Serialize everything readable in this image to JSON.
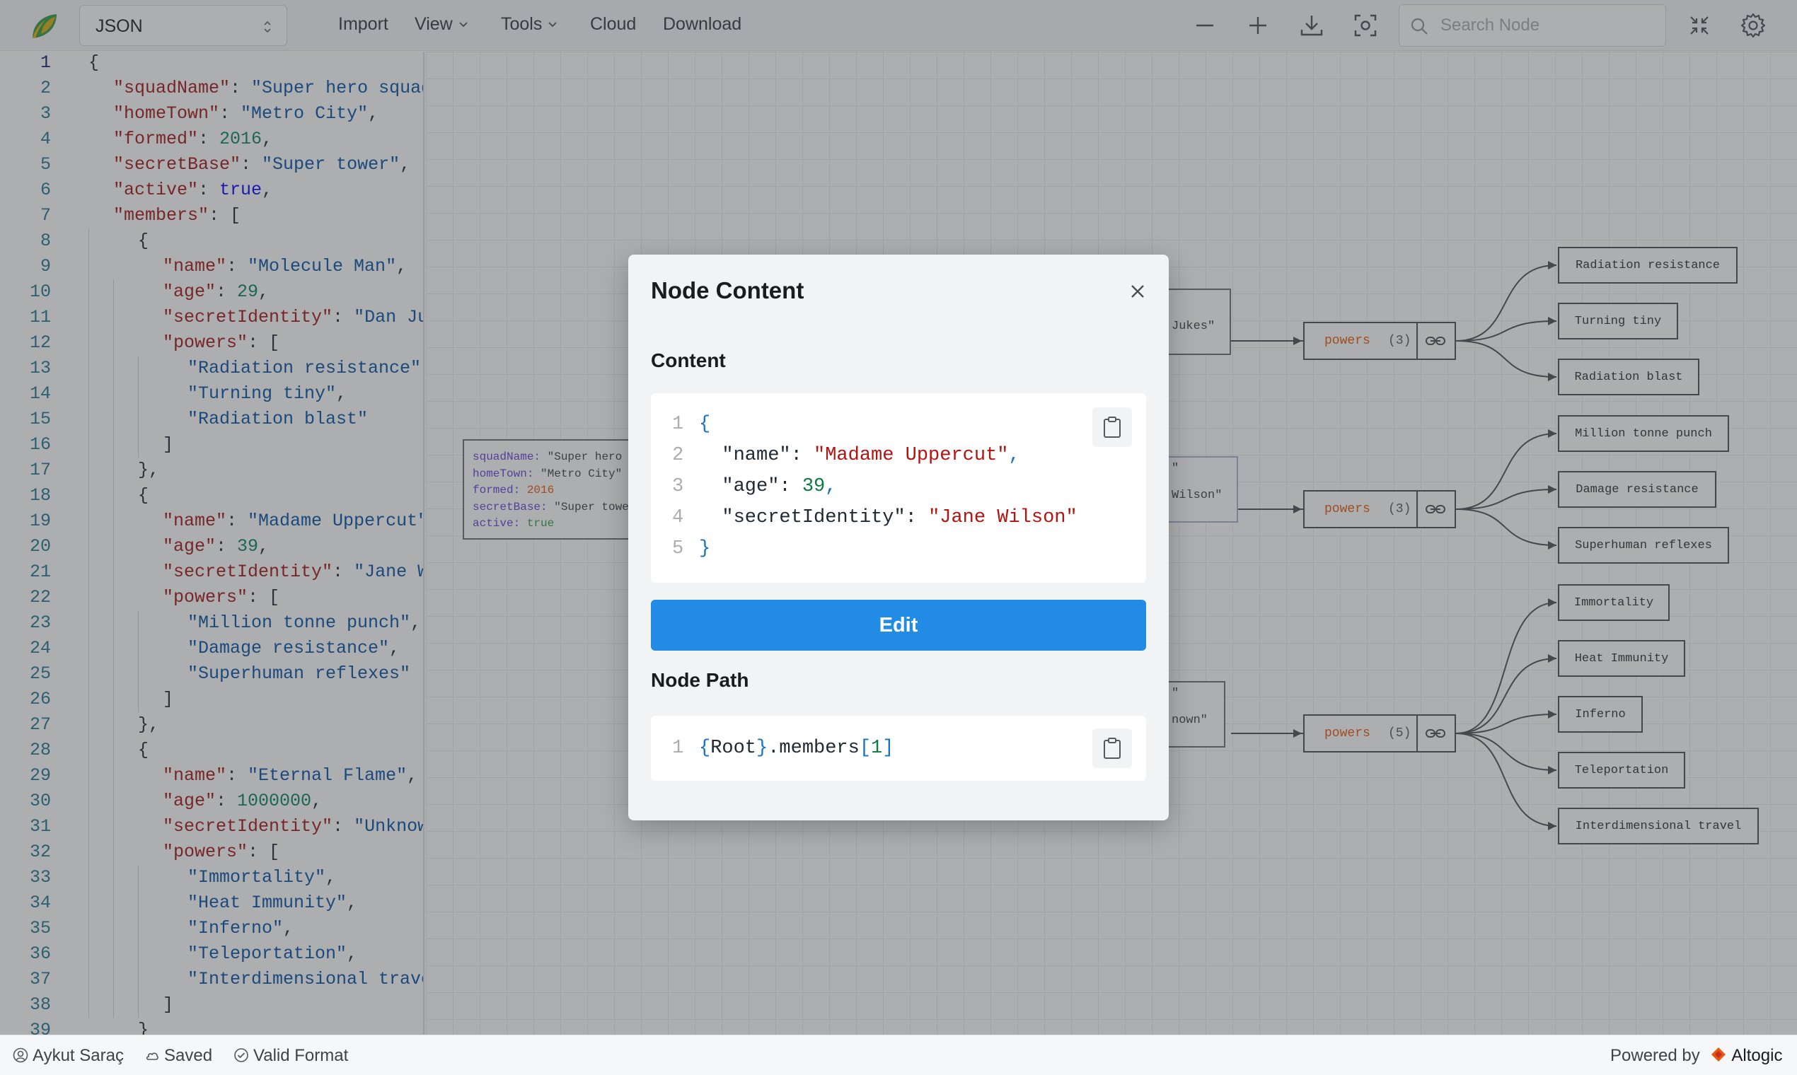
{
  "toolbar": {
    "format": "JSON",
    "menus": {
      "import": "Import",
      "view": "View",
      "tools": "Tools",
      "cloud": "Cloud",
      "download": "Download"
    },
    "search_placeholder": "Search Node",
    "icons": [
      "zoom-out-icon",
      "zoom-in-icon",
      "download-icon",
      "focus-icon",
      "fullscreen-icon",
      "settings-icon"
    ]
  },
  "editor": {
    "active_line": 1,
    "lines": [
      {
        "n": "1",
        "indent": 0,
        "parts": [
          [
            "p",
            "{"
          ]
        ]
      },
      {
        "n": "2",
        "indent": 1,
        "parts": [
          [
            "k",
            "\"squadName\""
          ],
          [
            "p",
            ": "
          ],
          [
            "s",
            "\"Super hero squad\""
          ]
        ]
      },
      {
        "n": "3",
        "indent": 1,
        "parts": [
          [
            "k",
            "\"homeTown\""
          ],
          [
            "p",
            ": "
          ],
          [
            "s",
            "\"Metro City\""
          ],
          [
            "p",
            ","
          ]
        ]
      },
      {
        "n": "4",
        "indent": 1,
        "parts": [
          [
            "k",
            "\"formed\""
          ],
          [
            "p",
            ": "
          ],
          [
            "n",
            "2016"
          ],
          [
            "p",
            ","
          ]
        ]
      },
      {
        "n": "5",
        "indent": 1,
        "parts": [
          [
            "k",
            "\"secretBase\""
          ],
          [
            "p",
            ": "
          ],
          [
            "s",
            "\"Super tower\""
          ],
          [
            "p",
            ","
          ]
        ]
      },
      {
        "n": "6",
        "indent": 1,
        "parts": [
          [
            "k",
            "\"active\""
          ],
          [
            "p",
            ": "
          ],
          [
            "b",
            "true"
          ],
          [
            "p",
            ","
          ]
        ]
      },
      {
        "n": "7",
        "indent": 1,
        "parts": [
          [
            "k",
            "\"members\""
          ],
          [
            "p",
            ": ["
          ]
        ]
      },
      {
        "n": "8",
        "indent": 2,
        "parts": [
          [
            "p",
            "{"
          ]
        ]
      },
      {
        "n": "9",
        "indent": 3,
        "parts": [
          [
            "k",
            "\"name\""
          ],
          [
            "p",
            ": "
          ],
          [
            "s",
            "\"Molecule Man\""
          ],
          [
            "p",
            ","
          ]
        ]
      },
      {
        "n": "10",
        "indent": 3,
        "parts": [
          [
            "k",
            "\"age\""
          ],
          [
            "p",
            ": "
          ],
          [
            "n",
            "29"
          ],
          [
            "p",
            ","
          ]
        ]
      },
      {
        "n": "11",
        "indent": 3,
        "parts": [
          [
            "k",
            "\"secretIdentity\""
          ],
          [
            "p",
            ": "
          ],
          [
            "s",
            "\"Dan Jukes\""
          ]
        ]
      },
      {
        "n": "12",
        "indent": 3,
        "parts": [
          [
            "k",
            "\"powers\""
          ],
          [
            "p",
            ": ["
          ]
        ]
      },
      {
        "n": "13",
        "indent": 4,
        "parts": [
          [
            "s",
            "\"Radiation resistance\""
          ],
          [
            "p",
            ","
          ]
        ]
      },
      {
        "n": "14",
        "indent": 4,
        "parts": [
          [
            "s",
            "\"Turning tiny\""
          ],
          [
            "p",
            ","
          ]
        ]
      },
      {
        "n": "15",
        "indent": 4,
        "parts": [
          [
            "s",
            "\"Radiation blast\""
          ]
        ]
      },
      {
        "n": "16",
        "indent": 3,
        "parts": [
          [
            "p",
            "]"
          ]
        ]
      },
      {
        "n": "17",
        "indent": 2,
        "parts": [
          [
            "p",
            "},"
          ]
        ]
      },
      {
        "n": "18",
        "indent": 2,
        "parts": [
          [
            "p",
            "{"
          ]
        ]
      },
      {
        "n": "19",
        "indent": 3,
        "parts": [
          [
            "k",
            "\"name\""
          ],
          [
            "p",
            ": "
          ],
          [
            "s",
            "\"Madame Uppercut\""
          ],
          [
            "p",
            ","
          ]
        ]
      },
      {
        "n": "20",
        "indent": 3,
        "parts": [
          [
            "k",
            "\"age\""
          ],
          [
            "p",
            ": "
          ],
          [
            "n",
            "39"
          ],
          [
            "p",
            ","
          ]
        ]
      },
      {
        "n": "21",
        "indent": 3,
        "parts": [
          [
            "k",
            "\"secretIdentity\""
          ],
          [
            "p",
            ": "
          ],
          [
            "s",
            "\"Jane Wilson\""
          ]
        ]
      },
      {
        "n": "22",
        "indent": 3,
        "parts": [
          [
            "k",
            "\"powers\""
          ],
          [
            "p",
            ": ["
          ]
        ]
      },
      {
        "n": "23",
        "indent": 4,
        "parts": [
          [
            "s",
            "\"Million tonne punch\""
          ],
          [
            "p",
            ","
          ]
        ]
      },
      {
        "n": "24",
        "indent": 4,
        "parts": [
          [
            "s",
            "\"Damage resistance\""
          ],
          [
            "p",
            ","
          ]
        ]
      },
      {
        "n": "25",
        "indent": 4,
        "parts": [
          [
            "s",
            "\"Superhuman reflexes\""
          ]
        ]
      },
      {
        "n": "26",
        "indent": 3,
        "parts": [
          [
            "p",
            "]"
          ]
        ]
      },
      {
        "n": "27",
        "indent": 2,
        "parts": [
          [
            "p",
            "},"
          ]
        ]
      },
      {
        "n": "28",
        "indent": 2,
        "parts": [
          [
            "p",
            "{"
          ]
        ]
      },
      {
        "n": "29",
        "indent": 3,
        "parts": [
          [
            "k",
            "\"name\""
          ],
          [
            "p",
            ": "
          ],
          [
            "s",
            "\"Eternal Flame\""
          ],
          [
            "p",
            ","
          ]
        ]
      },
      {
        "n": "30",
        "indent": 3,
        "parts": [
          [
            "k",
            "\"age\""
          ],
          [
            "p",
            ": "
          ],
          [
            "n",
            "1000000"
          ],
          [
            "p",
            ","
          ]
        ]
      },
      {
        "n": "31",
        "indent": 3,
        "parts": [
          [
            "k",
            "\"secretIdentity\""
          ],
          [
            "p",
            ": "
          ],
          [
            "s",
            "\"Unknown\""
          ]
        ]
      },
      {
        "n": "32",
        "indent": 3,
        "parts": [
          [
            "k",
            "\"powers\""
          ],
          [
            "p",
            ": ["
          ]
        ]
      },
      {
        "n": "33",
        "indent": 4,
        "parts": [
          [
            "s",
            "\"Immortality\""
          ],
          [
            "p",
            ","
          ]
        ]
      },
      {
        "n": "34",
        "indent": 4,
        "parts": [
          [
            "s",
            "\"Heat Immunity\""
          ],
          [
            "p",
            ","
          ]
        ]
      },
      {
        "n": "35",
        "indent": 4,
        "parts": [
          [
            "s",
            "\"Inferno\""
          ],
          [
            "p",
            ","
          ]
        ]
      },
      {
        "n": "36",
        "indent": 4,
        "parts": [
          [
            "s",
            "\"Teleportation\""
          ],
          [
            "p",
            ","
          ]
        ]
      },
      {
        "n": "37",
        "indent": 4,
        "parts": [
          [
            "s",
            "\"Interdimensional travel\""
          ]
        ]
      },
      {
        "n": "38",
        "indent": 3,
        "parts": [
          [
            "p",
            "]"
          ]
        ]
      },
      {
        "n": "39",
        "indent": 2,
        "parts": [
          [
            "p",
            "}"
          ]
        ]
      }
    ]
  },
  "canvas": {
    "root_node": [
      {
        "key": "squadName",
        "value": "\"Super hero",
        "type": "string"
      },
      {
        "key": "homeTown",
        "value": "\"Metro City\"",
        "type": "string"
      },
      {
        "key": "formed",
        "value": "2016",
        "type": "number"
      },
      {
        "key": "secretBase",
        "value": "\"Super towe",
        "type": "string"
      },
      {
        "key": "active",
        "value": "true",
        "type": "bool"
      }
    ],
    "member_fragments": [
      "Jukes\"",
      "Wilson\"",
      "nown\""
    ],
    "member_fragments_top": [
      "\"",
      "\"",
      "\""
    ],
    "powers_groups": [
      {
        "label": "powers",
        "count": "(3)",
        "items": [
          "Radiation resistance",
          "Turning tiny",
          "Radiation blast"
        ]
      },
      {
        "label": "powers",
        "count": "(3)",
        "items": [
          "Million tonne punch",
          "Damage resistance",
          "Superhuman reflexes"
        ]
      },
      {
        "label": "powers",
        "count": "(5)",
        "items": [
          "Immortality",
          "Heat Immunity",
          "Inferno",
          "Teleportation",
          "Interdimensional travel"
        ]
      }
    ]
  },
  "modal": {
    "title": "Node Content",
    "content_title": "Content",
    "content_lines": [
      {
        "n": "1",
        "parts": [
          [
            "p",
            "{"
          ]
        ]
      },
      {
        "n": "2",
        "parts": [
          [
            "k",
            "  \"name\": "
          ],
          [
            "s",
            "\"Madame Uppercut\""
          ],
          [
            "p",
            ","
          ]
        ]
      },
      {
        "n": "3",
        "parts": [
          [
            "k",
            "  \"age\": "
          ],
          [
            "n",
            "39"
          ],
          [
            "p",
            ","
          ]
        ]
      },
      {
        "n": "4",
        "parts": [
          [
            "k",
            "  \"secretIdentity\": "
          ],
          [
            "s",
            "\"Jane Wilson\""
          ]
        ]
      },
      {
        "n": "5",
        "parts": [
          [
            "p",
            "}"
          ]
        ]
      }
    ],
    "edit_label": "Edit",
    "path_title": "Node Path",
    "path_line": {
      "n": "1",
      "parts": [
        [
          "p",
          "{"
        ],
        [
          "k",
          "Root"
        ],
        [
          "p",
          "}"
        ],
        [
          "k",
          ".members"
        ],
        [
          "p",
          "["
        ],
        [
          "n",
          "1"
        ],
        [
          "p",
          "]"
        ]
      ]
    }
  },
  "status": {
    "user": "Aykut Saraç",
    "saved": "Saved",
    "valid": "Valid Format",
    "powered_by": "Powered by",
    "brand": "Altogic"
  },
  "colors": {
    "accent": "#228be6",
    "key": "#a31515",
    "string": "#0451a5",
    "number": "#098658",
    "canvas_key": "#6741d9",
    "powers_label": "#e8590c"
  }
}
